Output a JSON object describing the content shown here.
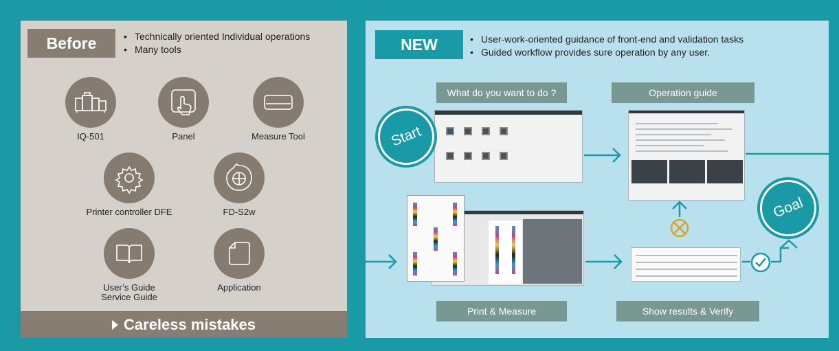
{
  "before": {
    "badge": "Before",
    "bullets": [
      "Technically oriented Individual operations",
      "Many tools"
    ],
    "tools": [
      {
        "label": "IQ-501",
        "icon": "printer-icon"
      },
      {
        "label": "Panel",
        "icon": "touch-panel-icon"
      },
      {
        "label": "Measure Tool",
        "icon": "measure-tool-icon"
      },
      {
        "label": "Printer controller DFE",
        "icon": "gear-icon"
      },
      {
        "label": "FD-S2w",
        "icon": "spectrophotometer-icon"
      },
      {
        "label": "User’s Guide\nService Guide",
        "icon": "book-icon"
      },
      {
        "label": "Application",
        "icon": "document-icon"
      }
    ],
    "footer": "Careless mistakes"
  },
  "new": {
    "badge": "NEW",
    "bullets": [
      "User-work-oriented guidance of front-end and validation tasks",
      "Guided workflow provides sure operation by any user."
    ],
    "start": "Start",
    "goal": "Goal",
    "steps": {
      "what": "What do you want to do ?",
      "guide": "Operation guide",
      "print": "Print & Measure",
      "verify": "Show results & Verify"
    }
  },
  "colors": {
    "teal": "#1a9aa6",
    "brown": "#877d73",
    "beige": "#d6d0ca",
    "light_blue": "#b9e1ed",
    "step_gray": "#7a9892",
    "x_mark": "#d9a42b"
  }
}
